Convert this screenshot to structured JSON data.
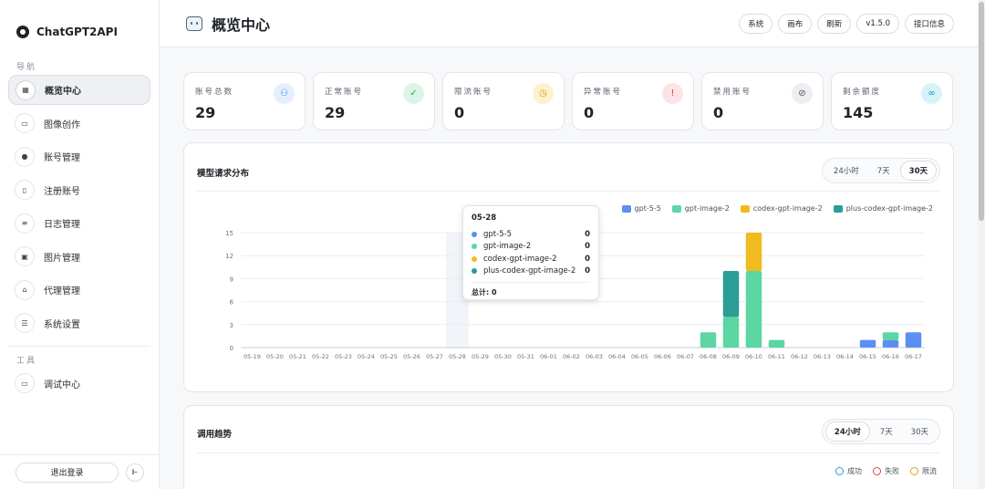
{
  "sidebar": {
    "brand": "ChatGPT2API",
    "nav_label": "导航",
    "tools_label": "工具",
    "items": [
      {
        "label": "概览中心",
        "icon": "dashboard-icon",
        "glyph": "▦",
        "active": true
      },
      {
        "label": "图像创作",
        "icon": "monitor-icon",
        "glyph": "▭",
        "active": false
      },
      {
        "label": "账号管理",
        "icon": "user-icon",
        "glyph": "●",
        "active": false
      },
      {
        "label": "注册账号",
        "icon": "register-icon",
        "glyph": "▯",
        "active": false
      },
      {
        "label": "日志管理",
        "icon": "list-icon",
        "glyph": "≡",
        "active": false
      },
      {
        "label": "图片管理",
        "icon": "images-icon",
        "glyph": "▣",
        "active": false
      },
      {
        "label": "代理管理",
        "icon": "lock-icon",
        "glyph": "⌂",
        "active": false
      },
      {
        "label": "系统设置",
        "icon": "sliders-icon",
        "glyph": "☰",
        "active": false
      }
    ],
    "tools": [
      {
        "label": "调试中心",
        "icon": "debug-icon",
        "glyph": "▭"
      }
    ],
    "logout": "退出登录",
    "collapse_glyph": "⊩"
  },
  "header": {
    "title": "概览中心",
    "buttons": [
      "系统",
      "画布",
      "刷新",
      "v1.5.0",
      "接口信息"
    ]
  },
  "stats": [
    {
      "label": "账号总数",
      "value": "29",
      "icon": "users-icon",
      "glyph": "⚇",
      "bg": "#e3f0fc",
      "color": "#3a8ee6"
    },
    {
      "label": "正常账号",
      "value": "29",
      "icon": "check-circle-icon",
      "glyph": "✓",
      "bg": "#dcf5e7",
      "color": "#22a55b"
    },
    {
      "label": "限流账号",
      "value": "0",
      "icon": "clock-icon",
      "glyph": "◷",
      "bg": "#fdf1cf",
      "color": "#d49b06"
    },
    {
      "label": "异常账号",
      "value": "0",
      "icon": "alert-circle-icon",
      "glyph": "!",
      "bg": "#fde3e5",
      "color": "#e0454f"
    },
    {
      "label": "禁用账号",
      "value": "0",
      "icon": "ban-icon",
      "glyph": "⊘",
      "bg": "#eceef1",
      "color": "#4a505b"
    },
    {
      "label": "剩余额度",
      "value": "145",
      "icon": "link-icon",
      "glyph": "∞",
      "bg": "#d6f3f9",
      "color": "#1596b8"
    }
  ],
  "model_panel": {
    "title": "模型请求分布",
    "tabs": [
      "24小时",
      "7天",
      "30天"
    ],
    "active_tab": 2
  },
  "trend_panel": {
    "title": "调用趋势",
    "tabs": [
      "24小时",
      "7天",
      "30天"
    ],
    "active_tab": 0,
    "legend": [
      {
        "label": "成功",
        "color": "#2f9bd8"
      },
      {
        "label": "失败",
        "color": "#e0454f"
      },
      {
        "label": "限流",
        "color": "#e6a019"
      }
    ]
  },
  "colors": {
    "gpt-5-5": "#5b8ff0",
    "gpt-image-2": "#5cd6a2",
    "codex-gpt-image-2": "#f1bb1f",
    "plus-codex-gpt-image-2": "#2a9d96"
  },
  "tooltip": {
    "date": "05-28",
    "rows": [
      {
        "name": "gpt-5-5",
        "value": "0",
        "color": "#5b8ff0"
      },
      {
        "name": "gpt-image-2",
        "value": "0",
        "color": "#5cd6a2"
      },
      {
        "name": "codex-gpt-image-2",
        "value": "0",
        "color": "#f1bb1f"
      },
      {
        "name": "plus-codex-gpt-image-2",
        "value": "0",
        "color": "#2a9d96"
      }
    ],
    "total": "总计: 0"
  },
  "chart_data": {
    "type": "bar",
    "stacked": true,
    "categories": [
      "05-19",
      "05-20",
      "05-21",
      "05-22",
      "05-23",
      "05-24",
      "05-25",
      "05-26",
      "05-27",
      "05-28",
      "05-29",
      "05-30",
      "05-31",
      "06-01",
      "06-02",
      "06-03",
      "06-04",
      "06-05",
      "06-06",
      "06-07",
      "06-08",
      "06-09",
      "06-10",
      "06-11",
      "06-12",
      "06-13",
      "06-14",
      "06-15",
      "06-16",
      "06-17"
    ],
    "series": [
      {
        "name": "gpt-5-5",
        "values": [
          0,
          0,
          0,
          0,
          0,
          0,
          0,
          0,
          0,
          0,
          0,
          0,
          0,
          0,
          0,
          0,
          0,
          0,
          0,
          0,
          0,
          0,
          0,
          0,
          0,
          0,
          0,
          1,
          1,
          2
        ]
      },
      {
        "name": "gpt-image-2",
        "values": [
          0,
          0,
          0,
          0,
          0,
          0,
          0,
          0,
          0,
          0,
          0,
          0,
          0,
          0,
          0,
          0,
          0,
          0,
          0,
          0,
          2,
          4,
          10,
          1,
          0,
          0,
          0,
          0,
          1,
          0
        ]
      },
      {
        "name": "codex-gpt-image-2",
        "values": [
          0,
          0,
          0,
          0,
          0,
          0,
          0,
          0,
          0,
          0,
          0,
          0,
          0,
          0,
          0,
          0,
          0,
          0,
          0,
          0,
          0,
          0,
          5,
          0,
          0,
          0,
          0,
          0,
          0,
          0
        ]
      },
      {
        "name": "plus-codex-gpt-image-2",
        "values": [
          0,
          0,
          0,
          0,
          0,
          0,
          0,
          0,
          0,
          0,
          0,
          0,
          0,
          0,
          0,
          0,
          0,
          0,
          0,
          0,
          0,
          6,
          0,
          0,
          0,
          0,
          0,
          0,
          0,
          0
        ]
      }
    ],
    "yticks": [
      0,
      3,
      6,
      9,
      12,
      15
    ],
    "ylim": [
      0,
      15
    ],
    "grid": true,
    "legend_position": "top-right",
    "highlight_category": "05-28"
  }
}
